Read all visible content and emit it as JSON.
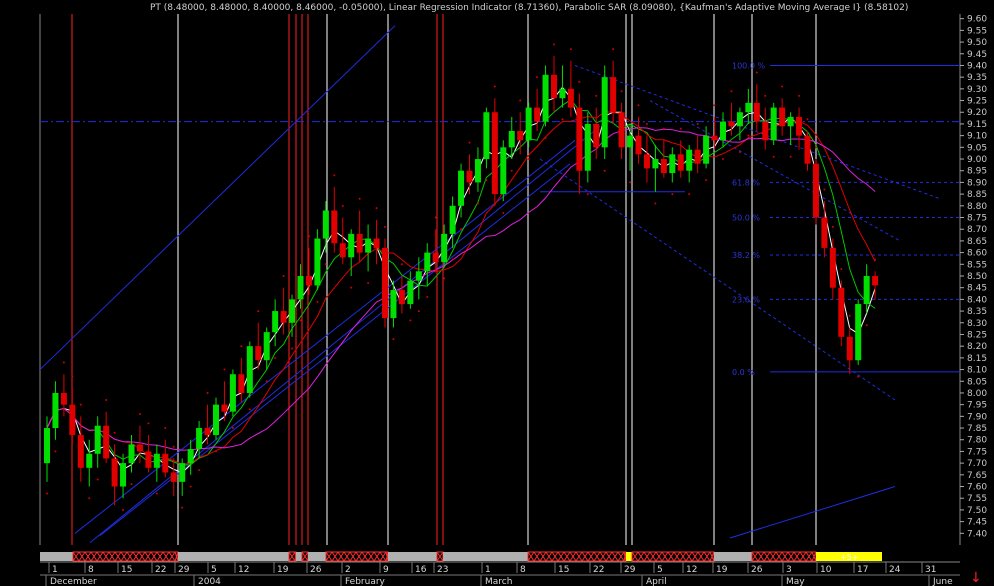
{
  "title": "PT (8.48000, 8.48000, 8.40000, 8.46000, -0.05000), Linear Regression Indicator (8.71360), Parabolic SAR (8.09080), {Kaufman's Adaptive Moving Average I} (8.58102)",
  "colors": {
    "background": "#000000",
    "up_candle": "#00e000",
    "down_candle": "#e00000",
    "sar": "#d00000",
    "channel": "#1e2ee0",
    "fib": "#1e2ee0",
    "red_vline": "#ff2020",
    "white_vline": "#ffffff",
    "ma_white": "#ffffff",
    "ma_green": "#00c800",
    "ma_red": "#e00000",
    "ma_magenta": "#e020e0",
    "band_gray": "#b0b0b0",
    "band_red": "#ff3030",
    "band_yellow": "#ffff00"
  },
  "icons": {
    "scroll": "down-arrow-icon"
  },
  "chart_data": {
    "type": "candlestick",
    "ylim": [
      7.35,
      9.62
    ],
    "y_ticks": [
      "9.60",
      "9.55",
      "9.50",
      "9.45",
      "9.40",
      "9.35",
      "9.30",
      "9.25",
      "9.20",
      "9.15",
      "9.10",
      "9.05",
      "9.00",
      "8.95",
      "8.90",
      "8.85",
      "8.80",
      "8.75",
      "8.70",
      "8.65",
      "8.60",
      "8.55",
      "8.50",
      "8.45",
      "8.40",
      "8.35",
      "8.30",
      "8.25",
      "8.20",
      "8.15",
      "8.10",
      "8.05",
      "8.00",
      "7.95",
      "7.90",
      "7.85",
      "7.80",
      "7.75",
      "7.70",
      "7.65",
      "7.60",
      "7.55",
      "7.50",
      "7.45",
      "7.40"
    ],
    "x_day_labels": [
      "1",
      "8",
      "15",
      "22",
      "29",
      "5",
      "12",
      "19",
      "26",
      "2",
      "9",
      "16",
      "23",
      "1",
      "8",
      "15",
      "22",
      "29",
      "5",
      "12",
      "19",
      "26",
      "3",
      "10",
      "17",
      "24",
      "31"
    ],
    "x_month_labels": [
      "December",
      "2004",
      "February",
      "March",
      "April",
      "May",
      "June"
    ],
    "fib_levels": [
      {
        "label": "100.0 %",
        "value": 9.4
      },
      {
        "label": "61.8 %",
        "value": 8.9
      },
      {
        "label": "50.0 %",
        "value": 8.75
      },
      {
        "label": "38.2 %",
        "value": 8.59
      },
      {
        "label": "23.6 %",
        "value": 8.4
      },
      {
        "label": "0.0 %",
        "value": 8.09
      }
    ],
    "highlight_label": "+5+",
    "ohlc": [
      [
        7.7,
        7.9,
        7.62,
        7.85
      ],
      [
        7.85,
        8.05,
        7.8,
        8.0
      ],
      [
        8.0,
        8.08,
        7.9,
        7.95
      ],
      [
        7.95,
        8.02,
        7.78,
        7.82
      ],
      [
        7.82,
        7.9,
        7.62,
        7.68
      ],
      [
        7.68,
        7.8,
        7.6,
        7.74
      ],
      [
        7.74,
        7.9,
        7.68,
        7.86
      ],
      [
        7.86,
        7.92,
        7.7,
        7.72
      ],
      [
        7.72,
        7.78,
        7.52,
        7.6
      ],
      [
        7.6,
        7.74,
        7.55,
        7.7
      ],
      [
        7.7,
        7.82,
        7.66,
        7.78
      ],
      [
        7.78,
        7.86,
        7.7,
        7.75
      ],
      [
        7.75,
        7.82,
        7.66,
        7.68
      ],
      [
        7.68,
        7.78,
        7.62,
        7.74
      ],
      [
        7.74,
        7.8,
        7.64,
        7.66
      ],
      [
        7.66,
        7.72,
        7.56,
        7.62
      ],
      [
        7.62,
        7.72,
        7.56,
        7.7
      ],
      [
        7.7,
        7.8,
        7.65,
        7.76
      ],
      [
        7.76,
        7.88,
        7.72,
        7.85
      ],
      [
        7.85,
        7.95,
        7.78,
        7.82
      ],
      [
        7.82,
        7.98,
        7.8,
        7.95
      ],
      [
        7.95,
        8.05,
        7.88,
        7.92
      ],
      [
        7.92,
        8.1,
        7.9,
        8.08
      ],
      [
        8.08,
        8.15,
        7.96,
        8.0
      ],
      [
        8.0,
        8.22,
        7.98,
        8.2
      ],
      [
        8.2,
        8.3,
        8.1,
        8.14
      ],
      [
        8.14,
        8.28,
        8.1,
        8.26
      ],
      [
        8.26,
        8.4,
        8.2,
        8.35
      ],
      [
        8.35,
        8.45,
        8.25,
        8.3
      ],
      [
        8.3,
        8.42,
        8.24,
        8.4
      ],
      [
        8.4,
        8.55,
        8.36,
        8.5
      ],
      [
        8.5,
        8.62,
        8.42,
        8.46
      ],
      [
        8.46,
        8.7,
        8.44,
        8.66
      ],
      [
        8.66,
        8.82,
        8.6,
        8.78
      ],
      [
        8.78,
        8.88,
        8.6,
        8.64
      ],
      [
        8.64,
        8.75,
        8.55,
        8.58
      ],
      [
        8.58,
        8.7,
        8.5,
        8.68
      ],
      [
        8.68,
        8.78,
        8.56,
        8.6
      ],
      [
        8.6,
        8.72,
        8.52,
        8.66
      ],
      [
        8.66,
        8.74,
        8.55,
        8.62
      ],
      [
        8.62,
        8.66,
        8.28,
        8.32
      ],
      [
        8.32,
        8.48,
        8.28,
        8.44
      ],
      [
        8.44,
        8.5,
        8.34,
        8.38
      ],
      [
        8.38,
        8.52,
        8.36,
        8.48
      ],
      [
        8.48,
        8.58,
        8.4,
        8.52
      ],
      [
        8.52,
        8.64,
        8.46,
        8.6
      ],
      [
        8.6,
        8.7,
        8.52,
        8.56
      ],
      [
        8.56,
        8.72,
        8.54,
        8.68
      ],
      [
        8.68,
        8.84,
        8.62,
        8.8
      ],
      [
        8.8,
        8.98,
        8.75,
        8.95
      ],
      [
        8.95,
        9.02,
        8.85,
        8.9
      ],
      [
        8.9,
        9.05,
        8.86,
        9.0
      ],
      [
        9.0,
        9.22,
        8.96,
        9.2
      ],
      [
        9.2,
        9.26,
        8.8,
        8.85
      ],
      [
        8.85,
        9.08,
        8.82,
        9.05
      ],
      [
        9.05,
        9.18,
        9.0,
        9.12
      ],
      [
        9.12,
        9.2,
        9.02,
        9.08
      ],
      [
        9.08,
        9.24,
        9.05,
        9.22
      ],
      [
        9.22,
        9.3,
        9.12,
        9.16
      ],
      [
        9.16,
        9.4,
        9.14,
        9.36
      ],
      [
        9.36,
        9.44,
        9.2,
        9.26
      ],
      [
        9.26,
        9.4,
        9.22,
        9.3
      ],
      [
        9.3,
        9.42,
        9.18,
        9.22
      ],
      [
        9.22,
        9.28,
        8.85,
        8.95
      ],
      [
        8.95,
        9.2,
        8.9,
        9.15
      ],
      [
        9.15,
        9.22,
        9.0,
        9.05
      ],
      [
        9.05,
        9.4,
        9.0,
        9.35
      ],
      [
        9.35,
        9.42,
        9.15,
        9.2
      ],
      [
        9.2,
        9.24,
        9.0,
        9.05
      ],
      [
        9.05,
        9.15,
        8.95,
        9.1
      ],
      [
        9.1,
        9.18,
        8.98,
        9.02
      ],
      [
        9.02,
        9.1,
        8.9,
        8.96
      ],
      [
        8.96,
        9.06,
        8.86,
        9.0
      ],
      [
        9.0,
        9.08,
        8.92,
        8.94
      ],
      [
        8.94,
        9.05,
        8.9,
        9.02
      ],
      [
        9.02,
        9.08,
        8.92,
        8.95
      ],
      [
        8.95,
        9.06,
        8.9,
        9.04
      ],
      [
        9.04,
        9.1,
        8.94,
        8.98
      ],
      [
        8.98,
        9.14,
        8.96,
        9.1
      ],
      [
        9.1,
        9.18,
        9.04,
        9.08
      ],
      [
        9.08,
        9.2,
        9.05,
        9.16
      ],
      [
        9.16,
        9.24,
        9.1,
        9.14
      ],
      [
        9.14,
        9.22,
        9.08,
        9.2
      ],
      [
        9.2,
        9.3,
        9.15,
        9.24
      ],
      [
        9.24,
        9.32,
        9.12,
        9.16
      ],
      [
        9.16,
        9.22,
        9.04,
        9.08
      ],
      [
        9.08,
        9.24,
        9.06,
        9.22
      ],
      [
        9.22,
        9.26,
        9.1,
        9.14
      ],
      [
        9.14,
        9.2,
        9.06,
        9.18
      ],
      [
        9.18,
        9.22,
        9.04,
        9.1
      ],
      [
        9.1,
        9.12,
        8.95,
        8.98
      ],
      [
        8.98,
        9.0,
        8.72,
        8.75
      ],
      [
        8.75,
        8.82,
        8.58,
        8.62
      ],
      [
        8.62,
        8.66,
        8.4,
        8.45
      ],
      [
        8.45,
        8.48,
        8.2,
        8.24
      ],
      [
        8.24,
        8.28,
        8.08,
        8.14
      ],
      [
        8.14,
        8.4,
        8.12,
        8.38
      ],
      [
        8.38,
        8.55,
        8.34,
        8.5
      ],
      [
        8.5,
        8.52,
        8.4,
        8.46
      ]
    ]
  }
}
